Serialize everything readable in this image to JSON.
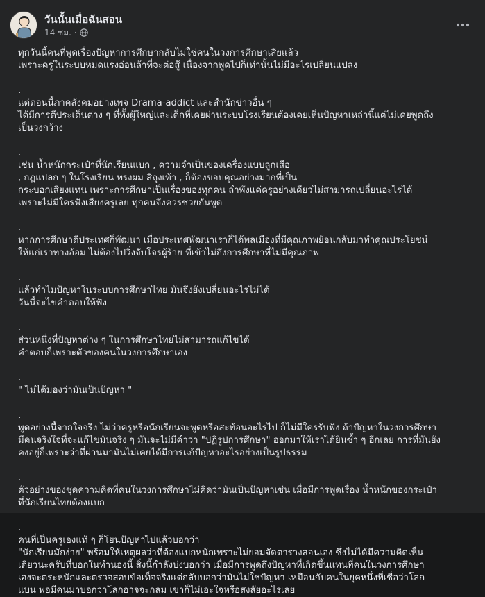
{
  "post": {
    "author": "วันนั้นเมื่อฉันสอน",
    "time": "14 ชม.",
    "separator": "·",
    "icons": {
      "privacy": "globe-icon",
      "menu": "more-horizontal-icon"
    },
    "lines": [
      "ทุกวันนี้คนที่พูดเรื่องปัญหาการศึกษากลับไม่ใช่คนในวงการศึกษาเสียแล้ว",
      "เพราะครูในระบบหมดแรงอ่อนล้าที่จะต่อสู้ เนื่องจากพูดไปก็เท่านั้นไม่มีอะไรเปลี่ยนแปลง",
      "",
      ".",
      "แต่ตอนนี้ภาคสังคมอย่างเพจ Drama-addict และสำนักข่าวอื่น ๆ",
      "ได้มีการตีประเด็นต่าง ๆ ที่ทั้งผู้ใหญ่และเด็กที่เคยผ่านระบบโรงเรียนต้องเคยเห็นปัญหาเหล่านี้แต่ไม่เคยพูดถึง",
      "เป็นวงกว้าง",
      "",
      ".",
      " เช่น น้ำหนักกระเป๋าที่นักเรียนแบก , ความจำเป็นของเครื่องแบบลูกเสือ",
      ", กฎแปลก ๆ ในโรงเรียน ทรงผม สีถุงเท้า , ก็ต้องขอบคุณอย่างมากที่เป็น",
      "กระบอกเสียงแทน เพราะการศึกษาเป็นเรื่องของทุกคน ลำพังแค่ครูอย่างเดียวไม่สามารถเปลี่ยนอะไรได้",
      "เพราะไม่มีใครฟังเสียงครูเลย ทุกคนจึงควรช่วยกันพูด",
      "",
      ".",
      "หากการศึกษาดีประเทศก็พัฒนา เมื่อประเทศพัฒนาเราก็ได้พลเมืองที่มีคุณภาพย้อนกลับมาทำคุณประโยชน์",
      "ให้แก่เราทางอ้อม ไม่ต้องไปวิ่งจับโจรผู้ร้าย ที่เข้าไม่ถึงการศึกษาที่ไม่มีคุณภาพ",
      "",
      ".",
      " แล้วทำไมปัญหาในระบบการศึกษาไทย มันจึงยังเปลี่ยนอะไรไม่ได้",
      "วันนี้จะไขคำตอบให้ฟัง",
      "",
      ".",
      "ส่วนหนึ่งที่ปัญหาต่าง ๆ ในการศึกษาไทยไม่สามารถแก้ไขได้",
      "คำตอบก็เพราะตัวของคนในวงการศึกษาเอง",
      "",
      ".",
      " \" ไม่ได้มองว่ามันเป็นปัญหา \"",
      "",
      ".",
      "พูดอย่างนี้จากใจจริง ไม่ว่าครูหรือนักเรียนจะพูดหรือสะท้อนอะไรไป ก็ไม่มีใครรับฟัง ถ้าปัญหาในวงการศึกษา",
      "มีคนจริงใจที่จะแก้ไขมันจริง ๆ มันจะไม่มีคำว่า \"ปฏิรูปการศึกษา\" ออกมาให้เราได้ยินซ้ำ ๆ อีกเลย การที่มันยัง",
      "คงอยู่ก็เพราะว่าที่ผ่านมามันไม่เคยได้มีการแก้ปัญหาอะไรอย่างเป็นรูปธรรม",
      "",
      ".",
      "ตัวอย่างของชุดความคิดที่คนในวงการศึกษาไม่คิดว่ามันเป็นปัญหาเช่น เมื่อมีการพูดเรื่อง น้ำหนักของกระเป๋า",
      "ที่นักเรียนไทยต้องแบก",
      "",
      ".",
      "คนที่เป็นครูเองแท้ ๆ ก็โยนปัญหาไปแล้วบอกว่า",
      " \"นักเรียนมักง่าย\" พร้อมให้เหตุผลว่าที่ต้องแบกหนักเพราะไม่ยอมจัดตารางสอนเอง ซึ่งไม่ได้มีความคิดเห็น",
      "เดียวนะครับที่บอกในทำนองนี้ สิ่งนี้กำลังบ่งบอกว่า เมื่อมีการพูดถึงปัญหาที่เกิดขึ้นแทนที่คนในวงการศึกษา",
      "เองจะตระหนักและตรวจสอบข้อเท็จจริงแต่กลับบอกว่ามันไม่ใช่ปัญหา เหมือนกับคนในยุคหนึ่งที่เชื่อว่าโลก",
      "แบน พอมีคนมาบอกว่าโลกอาจจะกลม เขาก็ไม่เอะใจหรือสงสัยอะไรเลย"
    ]
  }
}
